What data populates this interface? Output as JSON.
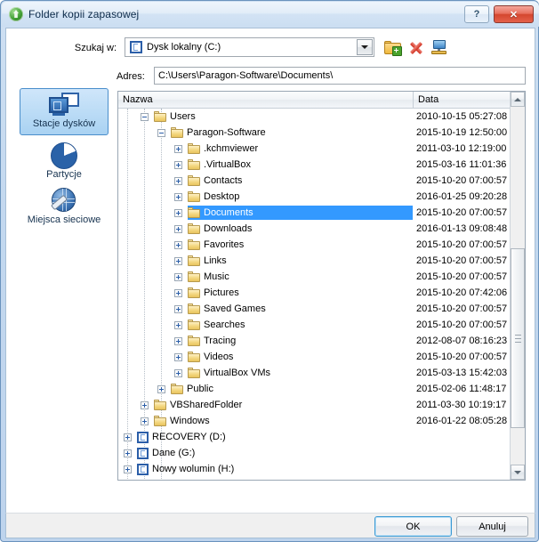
{
  "window": {
    "title": "Folder kopii zapasowej",
    "icon": "green-shield-icon",
    "help_label": "?",
    "close_label": "✕"
  },
  "lookin": {
    "label": "Szukaj w:",
    "value": "Dysk lokalny (C:)",
    "icon": "drive-icon"
  },
  "toolbar": {
    "new_folder": "new-folder-icon",
    "delete": "delete-icon",
    "map_network_drive": "map-network-drive-icon"
  },
  "address": {
    "label": "Adres:",
    "value": "C:\\Users\\Paragon-Software\\Documents\\",
    "placeholder": ""
  },
  "sidebar": {
    "items": [
      {
        "label": "Stacje dysków",
        "icon": "drives-icon",
        "selected": true
      },
      {
        "label": "Partycje",
        "icon": "partitions-pie-icon",
        "selected": false
      },
      {
        "label": "Miejsca sieciowe",
        "icon": "network-places-icon",
        "selected": false
      }
    ]
  },
  "tree": {
    "columns": [
      {
        "key": "name",
        "label": "Nazwa"
      },
      {
        "key": "date",
        "label": "Data"
      }
    ],
    "rows": [
      {
        "name": "Users",
        "date": "2010-10-15 05:27:08",
        "depth": 1,
        "expander": "minus",
        "icon": "folder-icon",
        "selected": false
      },
      {
        "name": "Paragon-Software",
        "date": "2015-10-19 12:50:00",
        "depth": 2,
        "expander": "minus",
        "icon": "folder-icon",
        "selected": false
      },
      {
        "name": ".kchmviewer",
        "date": "2011-03-10 12:19:00",
        "depth": 3,
        "expander": "plus",
        "icon": "folder-icon",
        "selected": false
      },
      {
        "name": ".VirtualBox",
        "date": "2015-03-16 11:01:36",
        "depth": 3,
        "expander": "plus",
        "icon": "folder-icon",
        "selected": false
      },
      {
        "name": "Contacts",
        "date": "2015-10-20 07:00:57",
        "depth": 3,
        "expander": "plus",
        "icon": "folder-icon",
        "selected": false
      },
      {
        "name": "Desktop",
        "date": "2016-01-25 09:20:28",
        "depth": 3,
        "expander": "plus",
        "icon": "folder-icon",
        "selected": false
      },
      {
        "name": "Documents",
        "date": "2015-10-20 07:00:57",
        "depth": 3,
        "expander": "plus",
        "icon": "folder-icon",
        "selected": true
      },
      {
        "name": "Downloads",
        "date": "2016-01-13 09:08:48",
        "depth": 3,
        "expander": "plus",
        "icon": "folder-icon",
        "selected": false
      },
      {
        "name": "Favorites",
        "date": "2015-10-20 07:00:57",
        "depth": 3,
        "expander": "plus",
        "icon": "folder-icon",
        "selected": false
      },
      {
        "name": "Links",
        "date": "2015-10-20 07:00:57",
        "depth": 3,
        "expander": "plus",
        "icon": "folder-icon",
        "selected": false
      },
      {
        "name": "Music",
        "date": "2015-10-20 07:00:57",
        "depth": 3,
        "expander": "plus",
        "icon": "folder-icon",
        "selected": false
      },
      {
        "name": "Pictures",
        "date": "2015-10-20 07:42:06",
        "depth": 3,
        "expander": "plus",
        "icon": "folder-icon",
        "selected": false
      },
      {
        "name": "Saved Games",
        "date": "2015-10-20 07:00:57",
        "depth": 3,
        "expander": "plus",
        "icon": "folder-icon",
        "selected": false
      },
      {
        "name": "Searches",
        "date": "2015-10-20 07:00:57",
        "depth": 3,
        "expander": "plus",
        "icon": "folder-icon",
        "selected": false
      },
      {
        "name": "Tracing",
        "date": "2012-08-07 08:16:23",
        "depth": 3,
        "expander": "plus",
        "icon": "folder-icon",
        "selected": false
      },
      {
        "name": "Videos",
        "date": "2015-10-20 07:00:57",
        "depth": 3,
        "expander": "plus",
        "icon": "folder-icon",
        "selected": false
      },
      {
        "name": "VirtualBox VMs",
        "date": "2015-03-13 15:42:03",
        "depth": 3,
        "expander": "plus",
        "icon": "folder-icon",
        "selected": false
      },
      {
        "name": "Public",
        "date": "2015-02-06 11:48:17",
        "depth": 2,
        "expander": "plus",
        "icon": "folder-icon",
        "selected": false
      },
      {
        "name": "VBSharedFolder",
        "date": "2011-03-30 10:19:17",
        "depth": 1,
        "expander": "plus",
        "icon": "folder-icon",
        "selected": false
      },
      {
        "name": "Windows",
        "date": "2016-01-22 08:05:28",
        "depth": 1,
        "expander": "plus",
        "icon": "folder-icon",
        "selected": false
      },
      {
        "name": "RECOVERY (D:)",
        "date": "",
        "depth": 0,
        "expander": "plus",
        "icon": "drive-icon",
        "selected": false
      },
      {
        "name": "Dane (G:)",
        "date": "",
        "depth": 0,
        "expander": "plus",
        "icon": "drive-icon",
        "selected": false
      },
      {
        "name": "Nowy wolumin (H:)",
        "date": "",
        "depth": 0,
        "expander": "plus",
        "icon": "drive-icon",
        "selected": false
      }
    ]
  },
  "scrollbar": {
    "up_arrow": "scroll-up-icon",
    "down_arrow": "scroll-down-icon"
  },
  "buttons": {
    "ok": "OK",
    "cancel": "Anuluj"
  },
  "colors": {
    "selection_blue": "#3399ff",
    "frame_blue": "#a7bfd6",
    "close_red": "#d4472f",
    "accent_focus": "#3c9ad4"
  }
}
